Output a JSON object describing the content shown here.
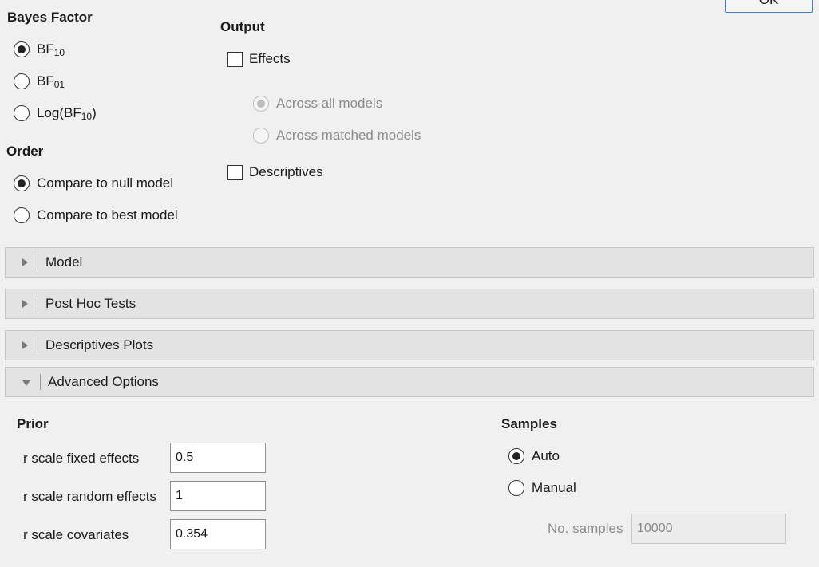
{
  "ok_button": "OK",
  "bayes_factor": {
    "title": "Bayes Factor",
    "options": [
      {
        "main": "BF",
        "sub": "10",
        "suffix": "",
        "selected": true
      },
      {
        "main": "BF",
        "sub": "01",
        "suffix": "",
        "selected": false
      },
      {
        "main": "Log(BF",
        "sub": "10",
        "suffix": ")",
        "selected": false
      }
    ]
  },
  "order": {
    "title": "Order",
    "options": [
      {
        "label": "Compare to null model",
        "selected": true
      },
      {
        "label": "Compare to best model",
        "selected": false
      }
    ]
  },
  "output": {
    "title": "Output",
    "effects_label": "Effects",
    "effects_checked": false,
    "effects_suboptions": [
      {
        "label": "Across all models",
        "selected": true
      },
      {
        "label": "Across matched models",
        "selected": false
      }
    ],
    "descriptives_label": "Descriptives",
    "descriptives_checked": false
  },
  "panels": [
    {
      "title": "Model",
      "expanded": false
    },
    {
      "title": "Post Hoc Tests",
      "expanded": false
    },
    {
      "title": "Descriptives Plots",
      "expanded": false
    },
    {
      "title": "Advanced Options",
      "expanded": true
    }
  ],
  "prior": {
    "title": "Prior",
    "fixed_label": "r scale fixed effects",
    "fixed_value": "0.5",
    "random_label": "r scale random effects",
    "random_value": "1",
    "covariates_label": "r scale covariates",
    "covariates_value": "0.354"
  },
  "samples": {
    "title": "Samples",
    "options": [
      {
        "label": "Auto",
        "selected": true
      },
      {
        "label": "Manual",
        "selected": false
      }
    ],
    "no_samples_label": "No. samples",
    "no_samples_value": "10000"
  }
}
